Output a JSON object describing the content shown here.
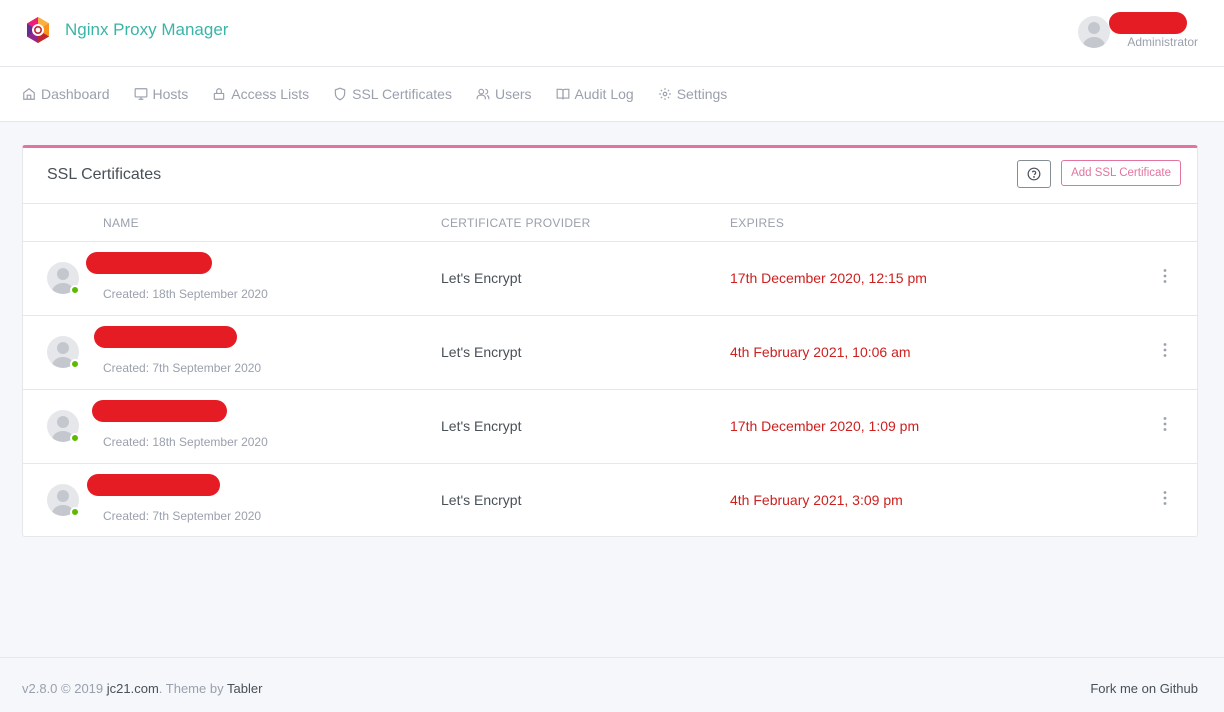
{
  "app": {
    "title": "Nginx Proxy Manager",
    "brand_color": "#3bb4a8",
    "accent_color": "#e2759f",
    "logo_icon": "npm-hexagon-logo-icon"
  },
  "user": {
    "role": "Administrator",
    "name_redacted": true,
    "avatar_icon": "user-avatar-icon"
  },
  "nav": {
    "items": [
      {
        "label": "Dashboard",
        "icon": "home-icon"
      },
      {
        "label": "Hosts",
        "icon": "monitor-icon"
      },
      {
        "label": "Access Lists",
        "icon": "lock-icon"
      },
      {
        "label": "SSL Certificates",
        "icon": "shield-icon"
      },
      {
        "label": "Users",
        "icon": "users-icon"
      },
      {
        "label": "Audit Log",
        "icon": "book-icon"
      },
      {
        "label": "Settings",
        "icon": "gear-icon"
      }
    ]
  },
  "card": {
    "title": "SSL Certificates",
    "help_icon": "help-circle-icon",
    "add_button": "Add SSL Certificate",
    "columns": {
      "name": "NAME",
      "provider": "CERTIFICATE PROVIDER",
      "expires": "EXPIRES"
    },
    "rows": [
      {
        "name_redacted": true,
        "created": "Created: 18th September 2020",
        "provider": "Let's Encrypt",
        "expires": "17th December 2020, 12:15 pm",
        "status": "online"
      },
      {
        "name_redacted": true,
        "created": "Created: 7th September 2020",
        "provider": "Let's Encrypt",
        "expires": "4th February 2021, 10:06 am",
        "status": "online"
      },
      {
        "name_redacted": true,
        "created": "Created: 18th September 2020",
        "provider": "Let's Encrypt",
        "expires": "17th December 2020, 1:09 pm",
        "status": "online"
      },
      {
        "name_redacted": true,
        "created": "Created: 7th September 2020",
        "provider": "Let's Encrypt",
        "expires": "4th February 2021, 3:09 pm",
        "status": "online"
      }
    ],
    "status_color": "#5eba00",
    "expires_color": "#cd201f",
    "redaction_color": "#e51c23"
  },
  "footer": {
    "version": "v2.8.0 © 2019",
    "author_link": "jc21.com",
    "theme_text": ". Theme by",
    "theme_link": "Tabler",
    "github_link": "Fork me on Github"
  }
}
